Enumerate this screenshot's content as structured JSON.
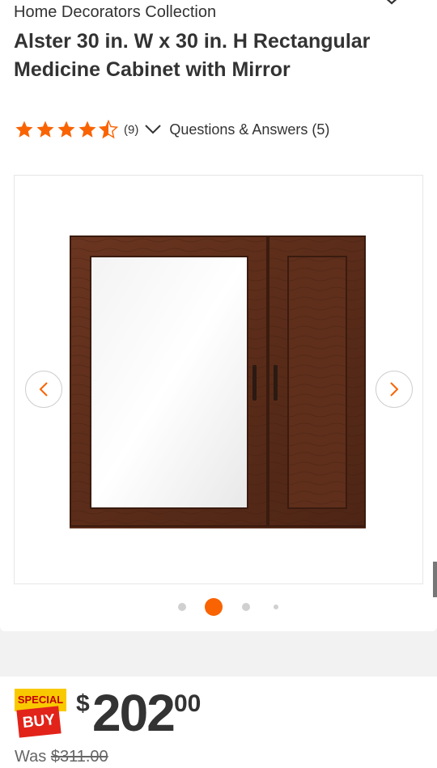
{
  "header": {
    "brand": "Home Decorators Collection",
    "title": "Alster 30 in. W x 30 in. H Rectangular Medicine Cabinet with Mirror"
  },
  "rating": {
    "stars": 4.5,
    "review_count": "(9)",
    "qa_link": "Questions & Answers (5)",
    "star_color": "#f96302"
  },
  "gallery": {
    "active_index": 1,
    "dot_count": 4,
    "active_color": "#f96302"
  },
  "pricing": {
    "badge_top": "SPECIAL",
    "badge_bottom": "BUY",
    "currency": "$",
    "dollars": "202",
    "cents": "00",
    "was_label": "Was",
    "was_price": "$311.00"
  }
}
